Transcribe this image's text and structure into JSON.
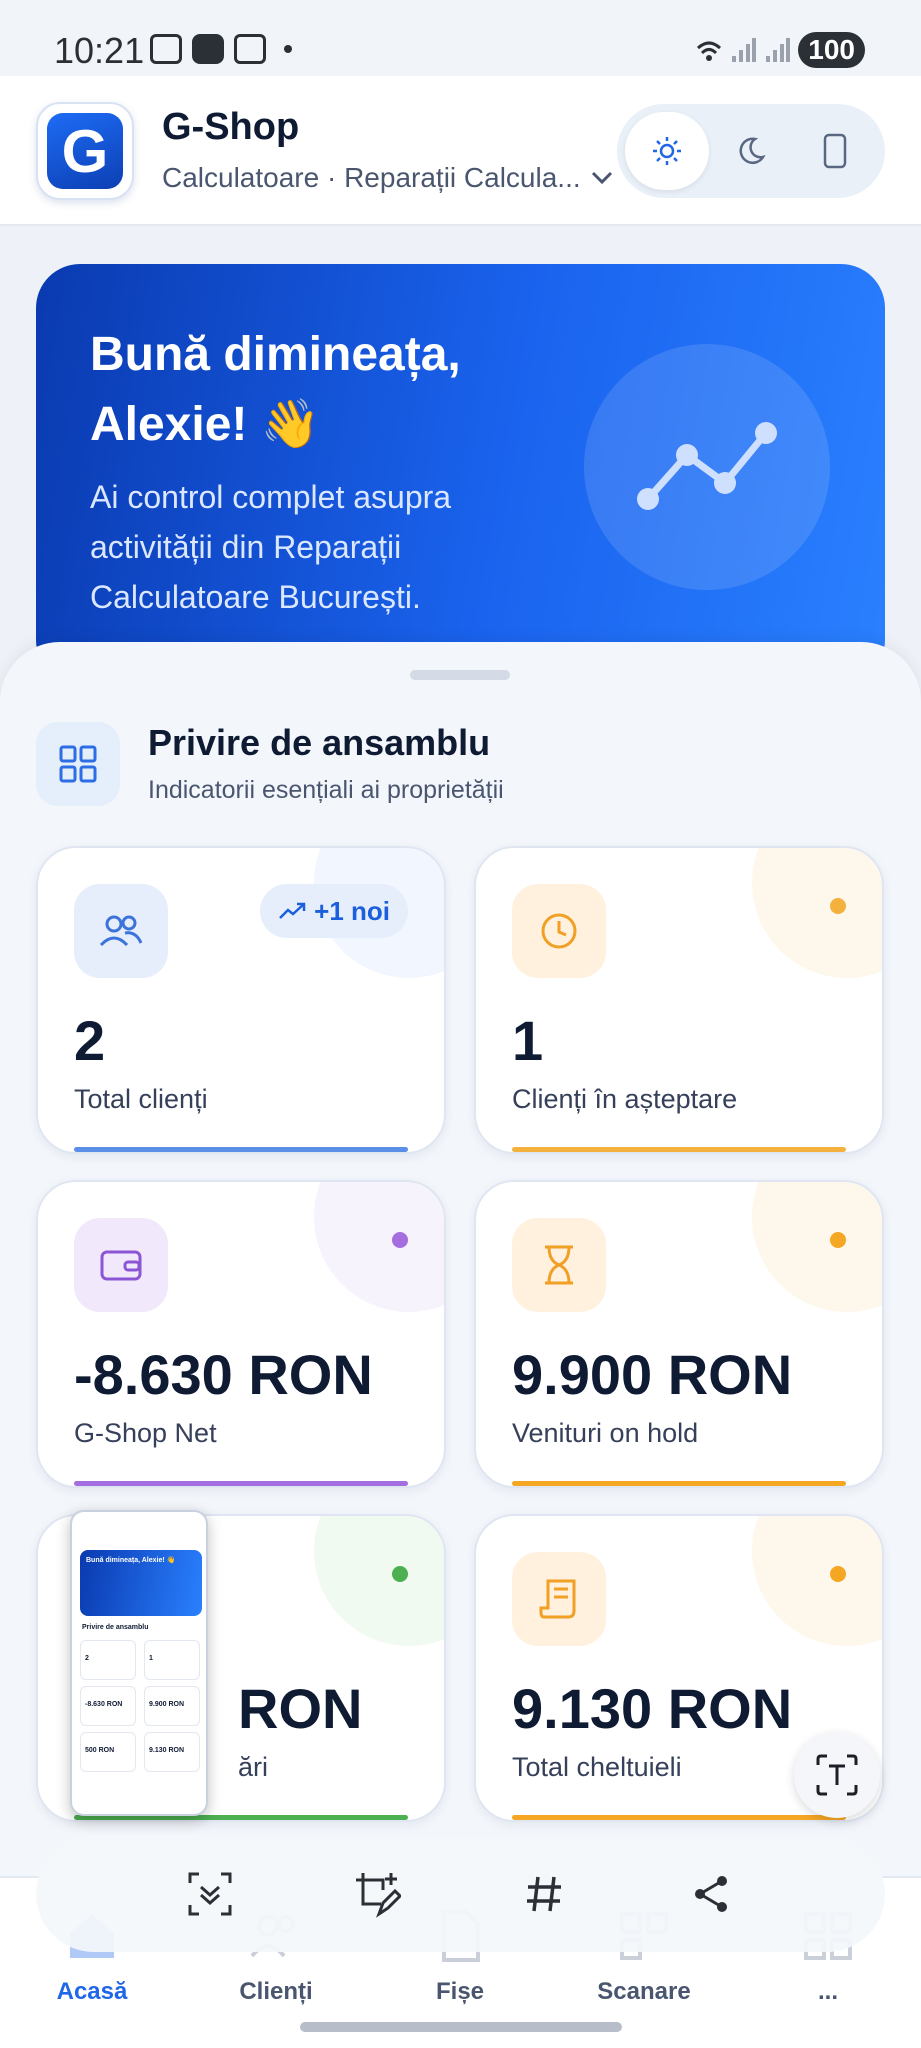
{
  "status_bar": {
    "time": "10:21",
    "battery": "100"
  },
  "header": {
    "logo_letter": "G",
    "title": "G-Shop",
    "subtitle": "Calculatoare · Reparații Calcula...",
    "theme_options": [
      "light-icon",
      "dark-icon",
      "device-icon"
    ],
    "active_theme": "light"
  },
  "hero": {
    "title": "Bună dimineața, Alexie! 👋",
    "text": "Ai control complet asupra activității din Reparații Calculatoare București."
  },
  "overview": {
    "title": "Privire de ansamblu",
    "subtitle": "Indicatorii esențiali ai proprietății"
  },
  "cards": [
    {
      "value": "2",
      "label": "Total clienți",
      "badge": "+1 noi",
      "color": "#5b8ee6",
      "icon": "users-icon"
    },
    {
      "value": "1",
      "label": "Clienți în așteptare",
      "color": "#f5b13e",
      "icon": "clock-icon"
    },
    {
      "value": "-8.630 RON",
      "label": "G-Shop Net",
      "color": "#a46ee0",
      "icon": "wallet-icon"
    },
    {
      "value": "9.900 RON",
      "label": "Venituri on hold",
      "color": "#f5a623",
      "icon": "hourglass-icon"
    },
    {
      "value": "RON",
      "label": "ări",
      "color": "#4caf50",
      "icon": "money-icon"
    },
    {
      "value": "9.130 RON",
      "label": "Total cheltuieli",
      "color": "#f5a623",
      "icon": "receipt-icon"
    }
  ],
  "thumbnail": {
    "hero_title": "Bună dimineața, Alexie! 👋",
    "section": "Privire de ansamblu",
    "values": [
      "2",
      "1",
      "-8.630 RON",
      "9.900 RON",
      "500 RON",
      "9.130 RON"
    ]
  },
  "bottom_nav": [
    {
      "label": "Acasă",
      "active": true
    },
    {
      "label": "Clienți",
      "active": false
    },
    {
      "label": "Fișe",
      "active": false
    },
    {
      "label": "Scanare",
      "active": false
    },
    {
      "label": "...",
      "active": false
    }
  ]
}
